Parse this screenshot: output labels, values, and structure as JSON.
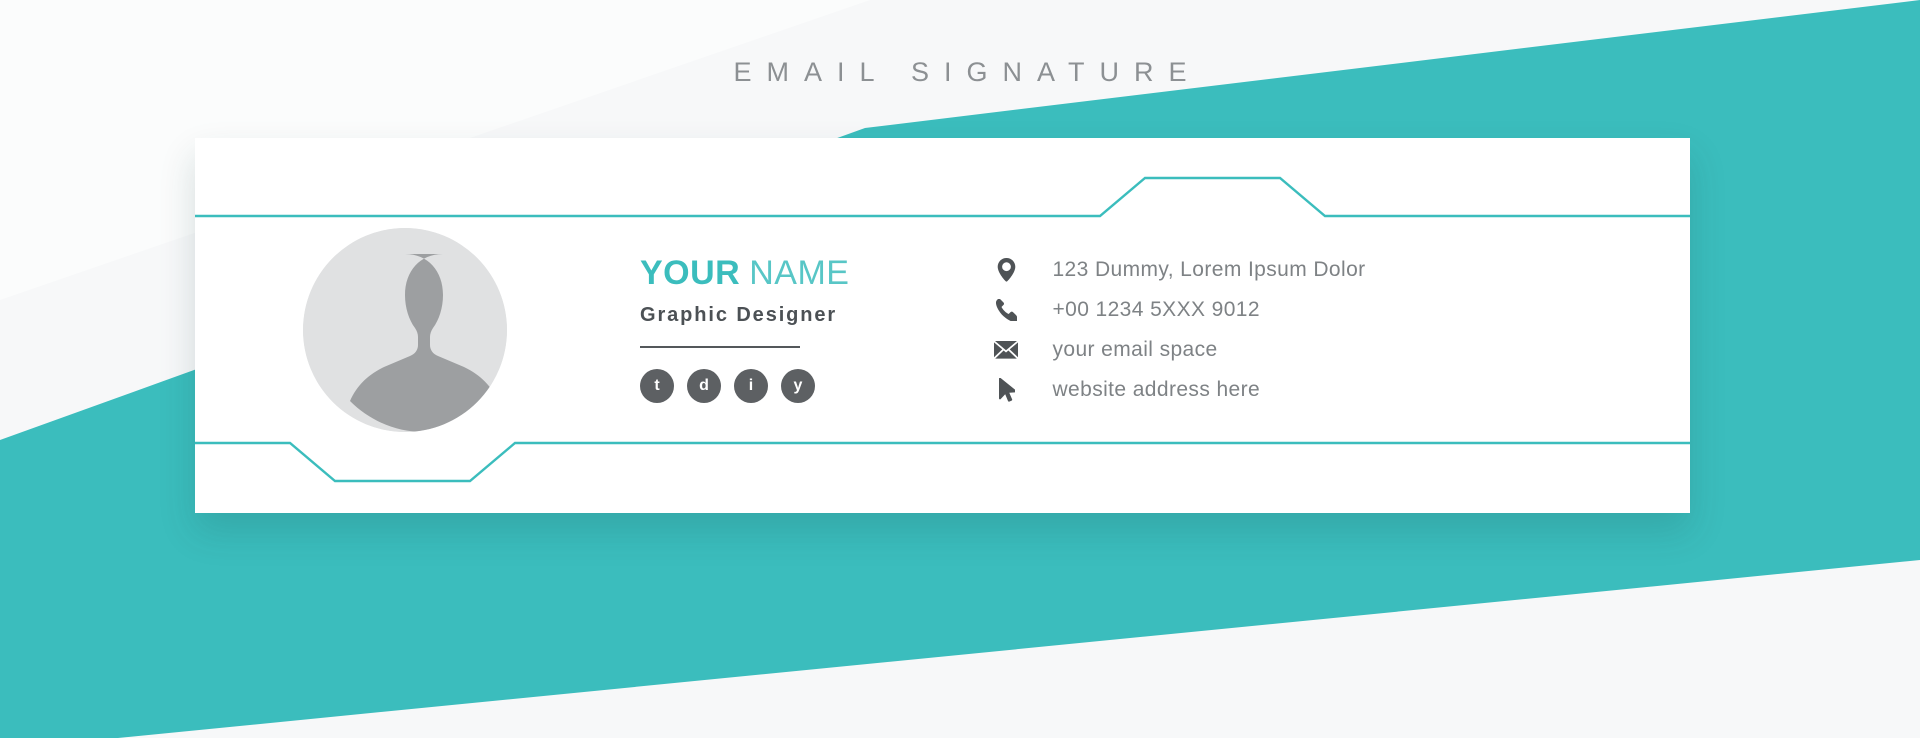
{
  "page": {
    "title": "EMAIL SIGNATURE"
  },
  "colors": {
    "accent_teal": "#3bbdbd",
    "background": "#f7f8f9",
    "card": "#ffffff",
    "name_bold": "#3bbdbd",
    "name_light": "#58c6c6",
    "job_title": "#4c5155",
    "contact_text": "#7e8285",
    "contact_icon": "#4f5356",
    "social_badge": "#5d6063",
    "avatar_circle": "#e0e1e2",
    "avatar_silhouette": "#9d9fa1",
    "divider": "#54585b"
  },
  "card": {
    "avatar": {
      "icon": "user-avatar-placeholder-icon"
    },
    "identity": {
      "name_first": "YOUR",
      "name_last": "NAME",
      "job_title": "Graphic Designer",
      "socials": [
        {
          "label": "t",
          "name": "twitter"
        },
        {
          "label": "d",
          "name": "dribbble"
        },
        {
          "label": "i",
          "name": "instagram"
        },
        {
          "label": "y",
          "name": "youtube"
        }
      ]
    },
    "contacts": [
      {
        "icon": "location-pin-icon",
        "text": "123 Dummy, Lorem Ipsum Dolor"
      },
      {
        "icon": "phone-icon",
        "text": "+00 1234 5XXX 9012"
      },
      {
        "icon": "envelope-icon",
        "text": "your email space"
      },
      {
        "icon": "cursor-arrow-icon",
        "text": "website address here"
      }
    ]
  }
}
